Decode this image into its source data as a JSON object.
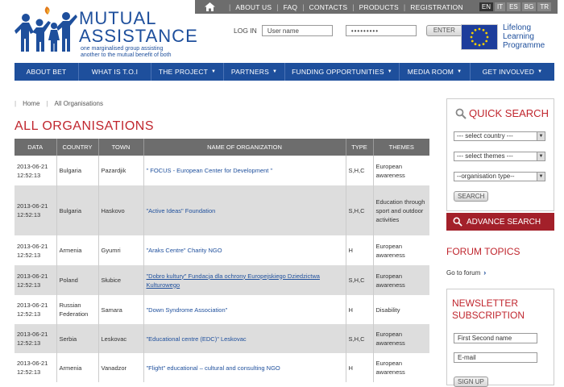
{
  "topbar": {
    "links": [
      "ABOUT US",
      "FAQ",
      "CONTACTS",
      "PRODUCTS",
      "REGISTRATION"
    ],
    "languages": [
      "EN",
      "IT",
      "ES",
      "BG",
      "TR"
    ],
    "active_language": "EN"
  },
  "logo": {
    "line1": "MUTUAL",
    "line2": "ASSISTANCE",
    "tagline1": "one marginalised group assisting",
    "tagline2": "another to the mutual benefit of both"
  },
  "login": {
    "label": "LOG IN",
    "username_placeholder": "User name",
    "password_value": "•••••••••",
    "button": "ENTER"
  },
  "llp": {
    "line1": "Lifelong",
    "line2": "Learning",
    "line3": "Programme"
  },
  "nav": [
    {
      "label": "ABOUT BET",
      "dropdown": false
    },
    {
      "label": "WHAT IS T.O.I",
      "dropdown": false
    },
    {
      "label": "THE PROJECT",
      "dropdown": true
    },
    {
      "label": "PARTNERS",
      "dropdown": true
    },
    {
      "label": "FUNDING OPPORTUNITIES",
      "dropdown": true
    },
    {
      "label": "MEDIA ROOM",
      "dropdown": true
    },
    {
      "label": "GET INVOLVED",
      "dropdown": true
    }
  ],
  "breadcrumb": {
    "home": "Home",
    "current": "All Organisations"
  },
  "page_title": "ALL ORGANISATIONS",
  "table": {
    "headers": [
      "DATA",
      "COUNTRY",
      "TOWN",
      "NAME OF ORGANIZATION",
      "TYPE",
      "THEMES"
    ],
    "rows": [
      {
        "date": "2013-06-21",
        "time": "12:52:13",
        "country": "Bulgaria",
        "town": "Pazardjik",
        "name": "\" FOCUS - European Center for Development \"",
        "type": "S,H,C",
        "themes": "European awareness"
      },
      {
        "date": "2013-06-21",
        "time": "12:52:13",
        "country": "Bulgaria",
        "town": "Haskovo",
        "name": "\"Active Ideas\" Foundation",
        "type": "S,H,C",
        "themes": "Education through sport and outdoor activities"
      },
      {
        "date": "2013-06-21",
        "time": "12:52:13",
        "country": "Armenia",
        "town": "Gyumri",
        "name": "\"Araks Centre\" Charity NGO",
        "type": "H",
        "themes": "European awareness"
      },
      {
        "date": "2013-06-21",
        "time": "12:52:13",
        "country": "Poland",
        "town": "Słubice",
        "name": "\"Dobro kultury\" Fundacja dla ochrony Europejskiego Dziedzictwa Kulturowego",
        "type": "S,H,C",
        "themes": "European awareness"
      },
      {
        "date": "2013-06-21",
        "time": "12:52:13",
        "country": "Russian Federation",
        "town": "Samara",
        "name": "\"Down Syndrome Association\"",
        "type": "H",
        "themes": "Disability"
      },
      {
        "date": "2013-06-21",
        "time": "12:52:13",
        "country": "Serbia",
        "town": "Leskovac",
        "name": "\"Educational centre (EDC)\" Leskovac",
        "type": "S,H,C",
        "themes": "European awareness"
      },
      {
        "date": "2013-06-21",
        "time": "12:52:13",
        "country": "Armenia",
        "town": "Vanadzor",
        "name": "\"Flight\" educational – cultural and consulting NGO",
        "type": "H",
        "themes": "European awareness"
      }
    ]
  },
  "quick_search": {
    "title": "QUICK SEARCH",
    "country": "--- select country ---",
    "themes": "--- select themes ---",
    "type": "--organisation type--",
    "button": "SEARCH"
  },
  "advanced_search": "ADVANCE SEARCH",
  "forum": {
    "title": "FORUM TOPICS",
    "link": "Go to forum"
  },
  "newsletter": {
    "title1": "NEWSLETTER",
    "title2": "SUBSCRIPTION",
    "name_placeholder": "First Second name",
    "email_placeholder": "E-mail",
    "button": "SIGN UP"
  },
  "colors": {
    "brand_blue": "#1e4f9c",
    "accent_red": "#c0262e",
    "dark_red": "#a3202a",
    "bar_gray": "#6d6d6d"
  }
}
